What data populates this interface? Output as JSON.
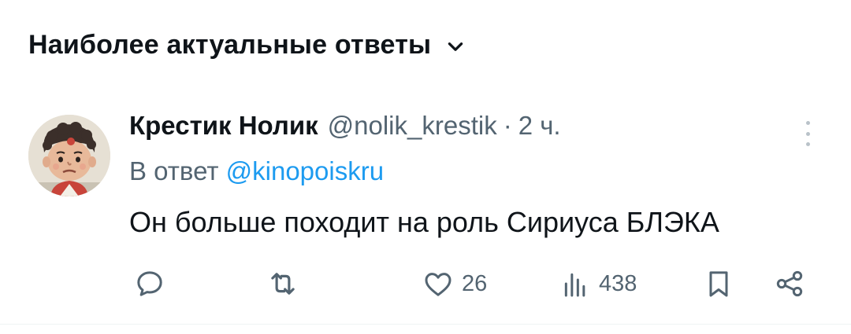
{
  "sort": {
    "label": "Наиболее актуальные ответы"
  },
  "reply": {
    "author": {
      "name": "Крестик Нолик",
      "handle": "@nolik_krestik"
    },
    "separator": "·",
    "time": "2 ч.",
    "reply_prefix": "В ответ",
    "reply_to": "@kinopoiskru",
    "text": "Он больше походит на роль Сириуса БЛЭКА",
    "stats": {
      "likes": "26",
      "views": "438"
    }
  },
  "colors": {
    "text_primary": "#0f1419",
    "text_secondary": "#536471",
    "accent": "#1d9bf0",
    "divider": "#eff3f4"
  },
  "icons": [
    "chevron-down-icon",
    "more-icon",
    "reply-icon",
    "retweet-icon",
    "like-icon",
    "views-icon",
    "bookmark-icon",
    "share-icon"
  ]
}
